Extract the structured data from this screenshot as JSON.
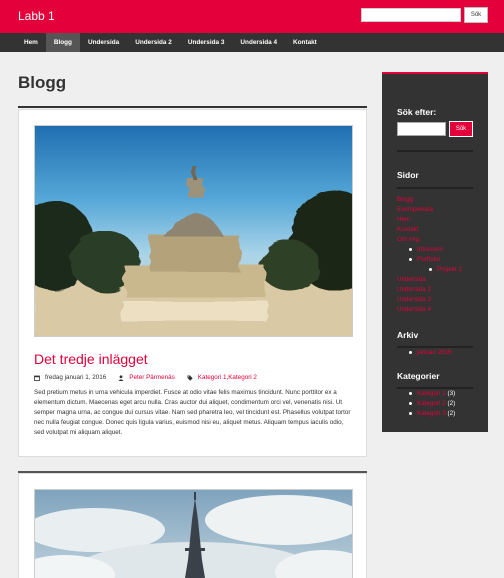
{
  "header": {
    "site_title": "Labb 1",
    "search_button": "Sök"
  },
  "nav": {
    "items": [
      {
        "label": "Hem"
      },
      {
        "label": "Blogg"
      },
      {
        "label": "Undersida"
      },
      {
        "label": "Undersida 2"
      },
      {
        "label": "Undersida 3"
      },
      {
        "label": "Undersida 4"
      },
      {
        "label": "Kontakt"
      }
    ],
    "active": "Blogg"
  },
  "main": {
    "page_title": "Blogg"
  },
  "posts": [
    {
      "title": "Det tredje inlägget",
      "date": "fredag januari 1, 2016",
      "author": "Peter Pärmenäs",
      "categories": [
        "Kategori 1",
        "Kategori 2"
      ],
      "category_separator": ", ",
      "excerpt": "Sed pretium metus in urna vehicula imperdiet. Fusce at odio vitae felis maximus tincidunt. Nunc porttitor ex a elementum dictum. Maecenas eget arcu nulla. Cras auctor dui aliquet, condimentum orci vel, venenatis nisi. Ut semper magna urna, ac congue dui cursus vitae. Nam sed pharetra leo, vel tincidunt est. Phasellus volutpat tortor nec nulla feugiat congue. Donec quis ligula varius, euismod nisi eu, aliquet metus. Aliquam tempus iaculis odio, sed volutpat mi aliquam aliquet."
    }
  ],
  "sidebar": {
    "search_title": "Sök efter:",
    "search_button": "Sök",
    "pages_title": "Sidor",
    "pages": [
      "Blogg",
      "Exempelsida",
      "Hem",
      "Kontakt",
      "Om mig"
    ],
    "pages_children": [
      "Intressen",
      "Portfolio"
    ],
    "pages_grandchildren": [
      "Projekt 1"
    ],
    "pages_more": [
      "Undersida",
      "Undersida 2",
      "Undersida 3",
      "Undersida 4"
    ],
    "archive_title": "Arkiv",
    "archive": [
      "januari 2016"
    ],
    "categories_title": "Kategorier",
    "categories": [
      {
        "name": "Kategori 1",
        "count": "(3)"
      },
      {
        "name": "Kategori 2",
        "count": "(2)"
      },
      {
        "name": "Kategori 3",
        "count": "(2)"
      }
    ]
  }
}
